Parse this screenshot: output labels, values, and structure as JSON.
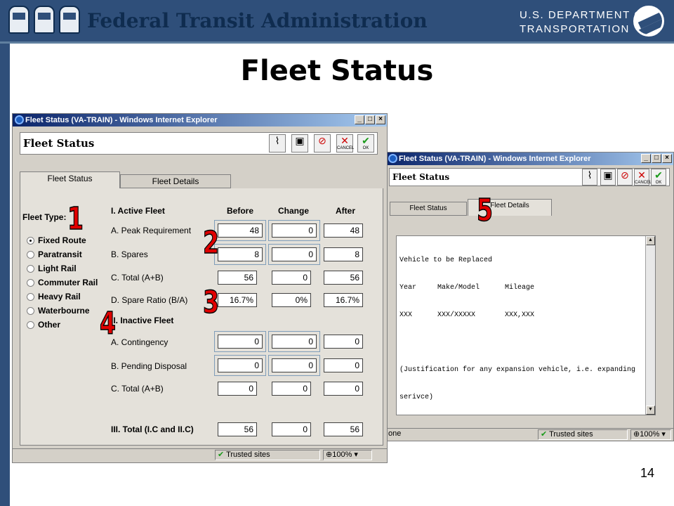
{
  "header": {
    "org_title": "Federal Transit Administration",
    "dot_line1": "U.S. DEPARTMENT OF",
    "dot_line2": "TRANSPORTATION"
  },
  "slide": {
    "title": "Fleet Status",
    "page_number": "14"
  },
  "left_window": {
    "title": "Fleet Status (VA-TRAIN) - Windows Internet Explorer",
    "form_title": "Fleet Status",
    "toolbar_buttons": [
      {
        "icon": "paperclip-icon",
        "label": ""
      },
      {
        "icon": "save-icon",
        "label": ""
      },
      {
        "icon": "delete-icon",
        "label": ""
      },
      {
        "icon": "cancel-icon",
        "label": "CANCEL"
      },
      {
        "icon": "ok-icon",
        "label": "OK"
      }
    ],
    "tabs": [
      "Fleet Status",
      "Fleet Details"
    ],
    "fleet_type_label": "Fleet Type:",
    "fleet_types": [
      "Fixed Route",
      "Paratransit",
      "Light Rail",
      "Commuter Rail",
      "Heavy Rail",
      "Waterbourne",
      "Other"
    ],
    "selected_fleet_type": "Fixed Route",
    "columns": [
      "Before",
      "Change",
      "After"
    ],
    "section1": "I. Active Fleet",
    "section2": "II. Inactive Fleet",
    "rows": [
      {
        "label": "A. Peak Requirement",
        "before": "48",
        "change": "0",
        "after": "48"
      },
      {
        "label": "B. Spares",
        "before": "8",
        "change": "0",
        "after": "8"
      },
      {
        "label": "C. Total (A+B)",
        "before": "56",
        "change": "0",
        "after": "56"
      },
      {
        "label": "D. Spare Ratio (B/A)",
        "before": "16.7%",
        "change": "0%",
        "after": "16.7%"
      },
      {
        "label": "A. Contingency",
        "before": "0",
        "change": "0",
        "after": "0"
      },
      {
        "label": "B. Pending Disposal",
        "before": "0",
        "change": "0",
        "after": "0"
      },
      {
        "label": "C. Total (A+B)",
        "before": "0",
        "change": "0",
        "after": "0"
      },
      {
        "label": "III. Total (I.C and II.C)",
        "before": "56",
        "change": "0",
        "after": "56"
      }
    ],
    "status_zone": "Trusted sites",
    "zoom": "100%"
  },
  "right_window": {
    "title": "Fleet Status (VA-TRAIN) - Windows Internet Explorer",
    "form_title": "Fleet Status",
    "tabs": [
      "Fleet Status",
      "Fleet Details"
    ],
    "details_lines": [
      "Vehicle to be Replaced",
      "Year     Make/Model      Mileage",
      "XXX      XXX/XXXXX       XXX,XXX",
      "",
      "(Justification for any expansion vehicle, i.e. expanding",
      "serivce)"
    ],
    "status_left": "one",
    "status_zone": "Trusted sites",
    "zoom": "100%"
  },
  "callouts": [
    "1",
    "2",
    "3",
    "4",
    "5"
  ],
  "colors": {
    "header_bg": "#2f4f7a",
    "callout_red": "#e00000",
    "title_navy": "#0f2c4f"
  }
}
